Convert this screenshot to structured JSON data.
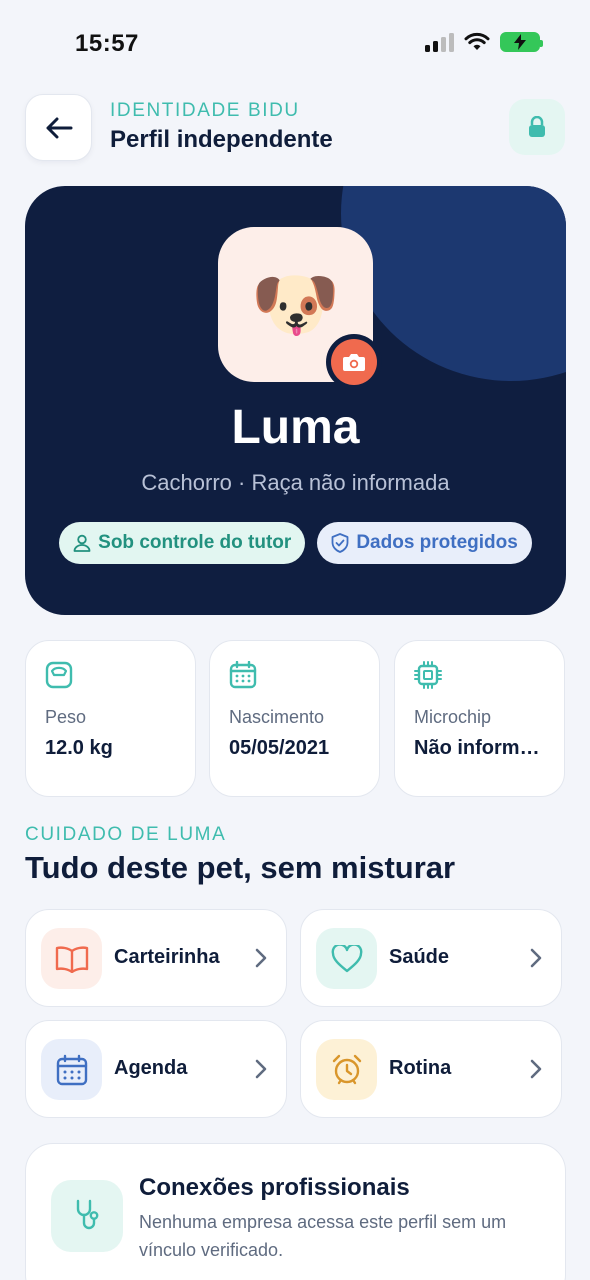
{
  "status_bar": {
    "time": "15:57"
  },
  "header": {
    "eyebrow": "IDENTIDADE BIDU",
    "title": "Perfil independente"
  },
  "pet": {
    "emoji": "🐶",
    "name": "Luma",
    "subtitle": "Cachorro · Raça não informada",
    "chips": [
      {
        "label": "Sob controle do tutor"
      },
      {
        "label": "Dados protegidos"
      }
    ]
  },
  "stats": [
    {
      "icon": "scale-icon",
      "label": "Peso",
      "value": "12.0 kg"
    },
    {
      "icon": "calendar-icon",
      "label": "Nascimento",
      "value": "05/05/2021"
    },
    {
      "icon": "chip-icon",
      "label": "Microchip",
      "value": "Não informado"
    }
  ],
  "care": {
    "eyebrow": "CUIDADO DE LUMA",
    "title": "Tudo deste pet, sem misturar",
    "tiles": [
      {
        "icon": "book-icon",
        "label": "Carteirinha",
        "color": "#f06a4e",
        "bg": "#fdeee9"
      },
      {
        "icon": "heart-icon",
        "label": "Saúde",
        "color": "#3fbcae",
        "bg": "#e4f6f2"
      },
      {
        "icon": "calendar-icon",
        "label": "Agenda",
        "color": "#3f6fc2",
        "bg": "#e8eefa"
      },
      {
        "icon": "alarm-icon",
        "label": "Rotina",
        "color": "#d9962b",
        "bg": "#fdf1d6"
      }
    ]
  },
  "connections": {
    "title": "Conexões profissionais",
    "description": "Nenhuma empresa acessa este perfil sem um vínculo verificado."
  },
  "colors": {
    "accent_teal": "#3fbcae",
    "hero_bg": "#0f1e40",
    "hero_circle": "#1c3870",
    "coral": "#f06a4e"
  }
}
